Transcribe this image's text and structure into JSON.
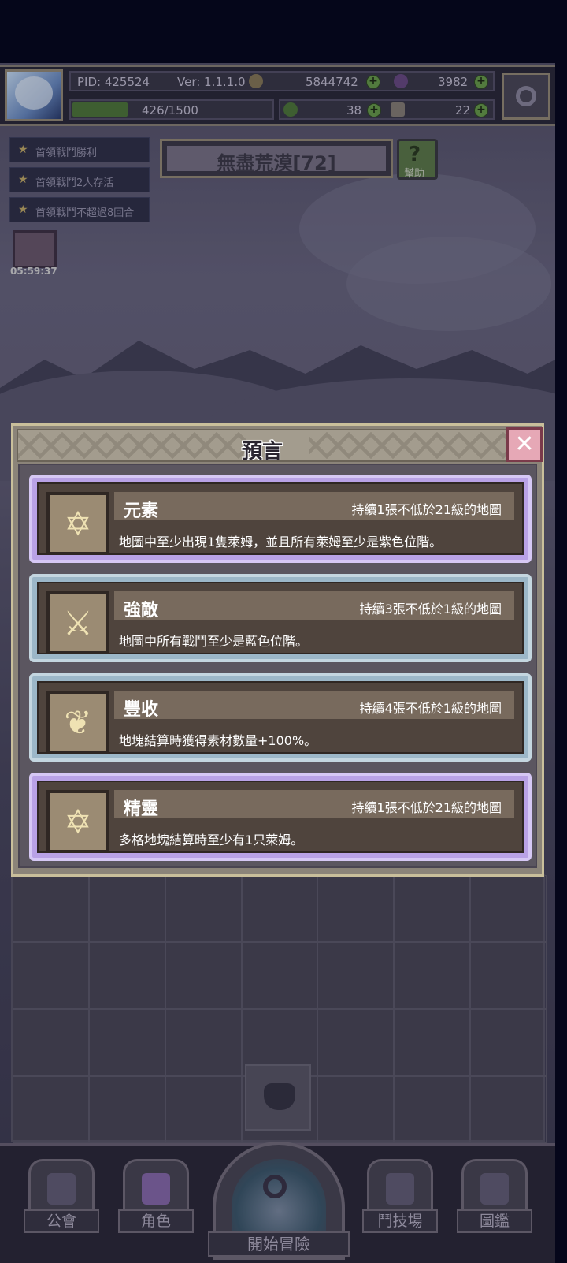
{
  "player": {
    "pid": "PID: 425524",
    "version": "Ver: 1.1.1.0",
    "exp": "426/1500",
    "gold": "5844742",
    "gems": "3982",
    "clover": "38",
    "keys": "22"
  },
  "quests": [
    {
      "label": "首領戰鬥勝利"
    },
    {
      "label": "首領戰鬥2人存活"
    },
    {
      "label": "首領戰鬥不超過8回合"
    }
  ],
  "chest_timer": "05:59:37",
  "stage": {
    "name": "無盡荒漠[72]",
    "help_label": "幫助"
  },
  "popup": {
    "title": "預言",
    "close": "✕",
    "cards": [
      {
        "name": "元素",
        "duration": "持續1張不低於21級的地圖",
        "desc": "地圖中至少出現1隻萊姆，並且所有萊姆至少是紫色位階。",
        "tier": "purple",
        "icon": "hexagram-icon",
        "glyph": "✡"
      },
      {
        "name": "強敵",
        "duration": "持續3張不低於1級的地圖",
        "desc": "地圖中所有戰鬥至少是藍色位階。",
        "tier": "blue",
        "icon": "crossed-swords-icon",
        "glyph": "⚔"
      },
      {
        "name": "豐收",
        "duration": "持續4張不低於1級的地圖",
        "desc": "地塊結算時獲得素材數量+100%。",
        "tier": "blue",
        "icon": "wheat-icon",
        "glyph": "❦"
      },
      {
        "name": "精靈",
        "duration": "持續1張不低於21級的地圖",
        "desc": "多格地塊結算時至少有1只萊姆。",
        "tier": "purple",
        "icon": "hexagram-icon",
        "glyph": "✡"
      }
    ]
  },
  "nav": {
    "guild": "公會",
    "character": "角色",
    "start": "開始冒險",
    "arena": "鬥技場",
    "codex": "圖鑑"
  },
  "colors": {
    "purple_tier": "#b9a2e6",
    "blue_tier": "#9cb7c8",
    "close_button": "#e6a8b6"
  }
}
